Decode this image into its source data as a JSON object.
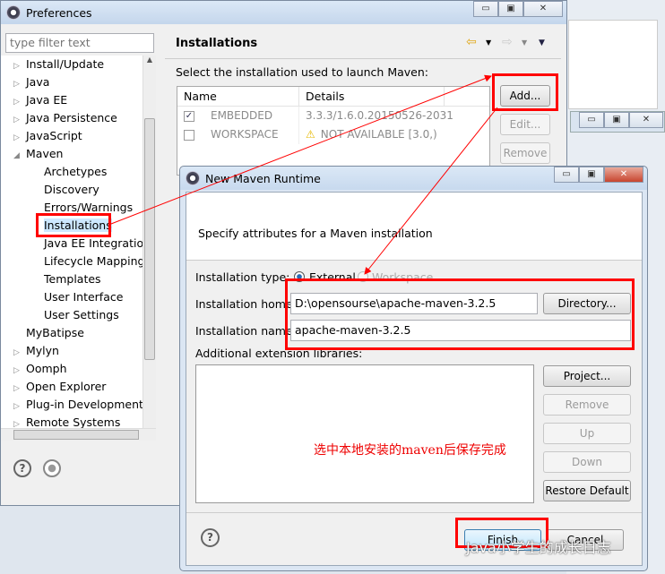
{
  "preferences": {
    "title": "Preferences",
    "filter_placeholder": "type filter text",
    "tree": [
      {
        "label": "Install/Update",
        "level": 0,
        "expander": "collapsed"
      },
      {
        "label": "Java",
        "level": 0,
        "expander": "collapsed"
      },
      {
        "label": "Java EE",
        "level": 0,
        "expander": "collapsed"
      },
      {
        "label": "Java Persistence",
        "level": 0,
        "expander": "collapsed"
      },
      {
        "label": "JavaScript",
        "level": 0,
        "expander": "collapsed"
      },
      {
        "label": "Maven",
        "level": 0,
        "expander": "expanded"
      },
      {
        "label": "Archetypes",
        "level": 1
      },
      {
        "label": "Discovery",
        "level": 1
      },
      {
        "label": "Errors/Warnings",
        "level": 1
      },
      {
        "label": "Installations",
        "level": 1,
        "selected": true
      },
      {
        "label": "Java EE Integration",
        "level": 1
      },
      {
        "label": "Lifecycle Mapping",
        "level": 1
      },
      {
        "label": "Templates",
        "level": 1
      },
      {
        "label": "User Interface",
        "level": 1
      },
      {
        "label": "User Settings",
        "level": 1
      },
      {
        "label": "MyBatipse",
        "level": 0
      },
      {
        "label": "Mylyn",
        "level": 0,
        "expander": "collapsed"
      },
      {
        "label": "Oomph",
        "level": 0,
        "expander": "collapsed"
      },
      {
        "label": "Open Explorer",
        "level": 0,
        "expander": "collapsed"
      },
      {
        "label": "Plug-in Development",
        "level": 0,
        "expander": "collapsed"
      },
      {
        "label": "Remote Systems",
        "level": 0,
        "expander": "collapsed"
      }
    ],
    "page_title": "Installations",
    "description": "Select the installation used to launch Maven:",
    "table": {
      "columns": [
        "Name",
        "Details"
      ],
      "rows": [
        {
          "checked": true,
          "name": "EMBEDDED",
          "details": "3.3.3/1.6.0.20150526-2031",
          "warning": false
        },
        {
          "checked": false,
          "name": "WORKSPACE",
          "details": "NOT AVAILABLE [3.0,)",
          "warning": true
        }
      ]
    },
    "buttons": {
      "add": "Add...",
      "edit": "Edit...",
      "remove": "Remove"
    }
  },
  "dialog": {
    "title": "New Maven Runtime",
    "header": "Specify attributes for a Maven installation",
    "type_label": "Installation type:",
    "type_options": [
      {
        "label": "External",
        "selected": true
      },
      {
        "label": "Workspace",
        "selected": false,
        "disabled": true
      }
    ],
    "home_label": "Installation home:",
    "home_value": "D:\\opensourse\\apache-maven-3.2.5",
    "directory_button": "Directory...",
    "name_label": "Installation name:",
    "name_value": "apache-maven-3.2.5",
    "libs_label": "Additional extension libraries:",
    "lib_buttons": {
      "project": "Project...",
      "remove": "Remove",
      "up": "Up",
      "down": "Down",
      "restore": "Restore Default"
    },
    "finish": "Finish",
    "cancel": "Cancel"
  },
  "annotation": "选中本地安装的maven后保存完成",
  "watermark": "Java小学生的成长日志",
  "colors": {
    "annotation_red": "#ff0000",
    "selection_border": "#ff0000"
  }
}
